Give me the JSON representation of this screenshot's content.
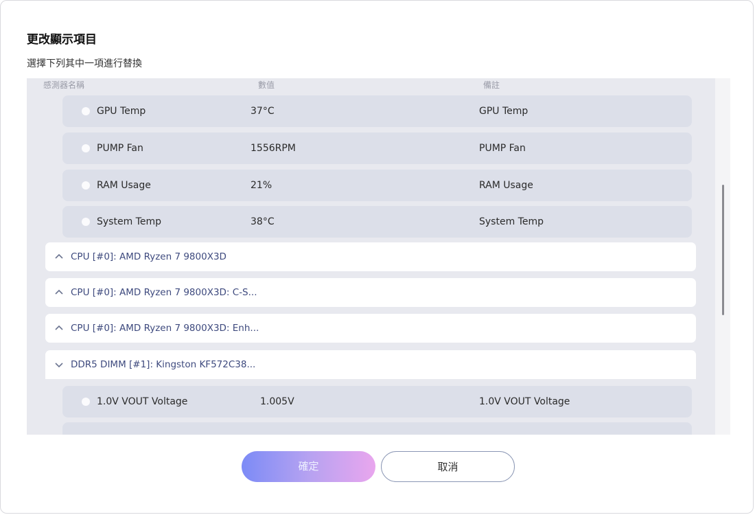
{
  "dialog": {
    "title": "更改顯示項目",
    "subtitle": "選擇下列其中一項進行替換"
  },
  "columns": {
    "name": "感測器名稱",
    "value": "數值",
    "note": "備註"
  },
  "top_group_rows": [
    {
      "name": "GPU Temp",
      "value": "37°C",
      "note": "GPU Temp"
    },
    {
      "name": "PUMP Fan",
      "value": "1556RPM",
      "note": "PUMP Fan"
    },
    {
      "name": "RAM Usage",
      "value": "21%",
      "note": "RAM Usage"
    },
    {
      "name": "System Temp",
      "value": "38°C",
      "note": "System Temp"
    }
  ],
  "collapsed_groups": [
    {
      "label": "CPU [#0]: AMD Ryzen 7 9800X3D",
      "state": "collapsed"
    },
    {
      "label": "CPU [#0]: AMD Ryzen 7 9800X3D: C-S...",
      "state": "collapsed"
    },
    {
      "label": "CPU [#0]: AMD Ryzen 7 9800X3D: Enh...",
      "state": "collapsed"
    }
  ],
  "expanded_group": {
    "label": "DDR5 DIMM [#1]: Kingston KF572C38...",
    "state": "expanded",
    "rows": [
      {
        "name": "1.0V VOUT Voltage",
        "value": "1.005V",
        "note": "1.0V VOUT Voltage"
      }
    ]
  },
  "buttons": {
    "confirm": "確定",
    "cancel": "取消"
  },
  "colors": {
    "panel_bg": "#e8e9ef",
    "row_bg": "#dcdfe9",
    "group_label": "#3e4a7e",
    "confirm_gradient_start": "#7c8bf6",
    "confirm_gradient_end": "#e9a6ee"
  }
}
